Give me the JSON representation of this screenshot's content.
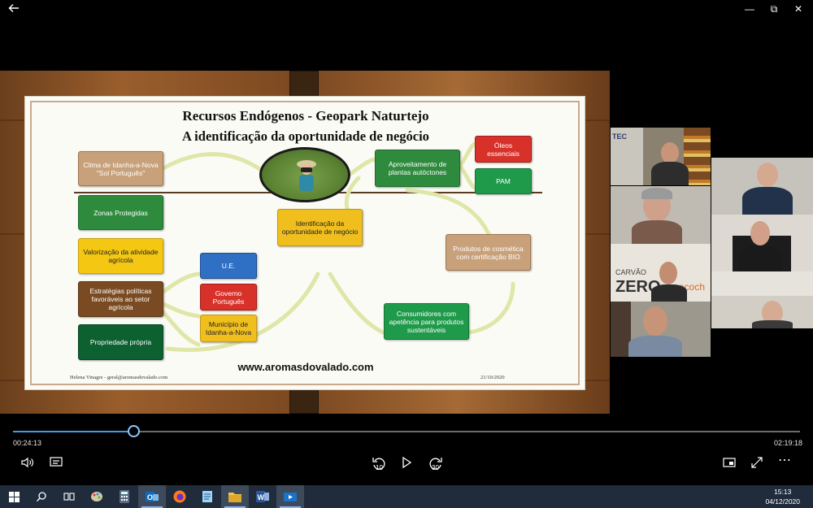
{
  "window": {
    "back_icon": "back-arrow-icon",
    "minimize": "—",
    "restore": "⧉",
    "close": "✕"
  },
  "slide": {
    "title_line1": "Recursos Endógenos  - Geopark Naturtejo",
    "title_line2": "A identificação da oportunidade de negócio",
    "boxes": {
      "clima": "Clima de Idanha-a-Nova \"Sol Português\"",
      "zonas": "Zonas Protegidas",
      "valorizacao": "Valorização da atividade agrícola",
      "estrategias": "Estratégias políticas favoráveis ao setor agrícola",
      "propriedade": "Propriedade própria",
      "ue": "U.E.",
      "governo": "Governo Português",
      "municipio": "Município de Idanha-a-Nova",
      "identificacao": "Identificação da oportunidade de negócio",
      "aproveitamento": "Aproveitamento de plantas autóctones",
      "oleos": "Óleos essenciais",
      "pam": "PAM",
      "produtos": "Produtos de cosmética com certificação BIO",
      "consumidores": "Consumidores com apetência para produtos sustentáveis"
    },
    "url": "www.aromasdovalado.com",
    "footer_left": "Helena Vinagre - geral@aromasdovalado.com",
    "footer_right": "21/10/2020"
  },
  "participants": [
    {
      "name": "participant-1",
      "bg": "#6e6a5c"
    },
    {
      "name": "participant-2",
      "bg": "#b5b0a6"
    },
    {
      "name": "participant-3",
      "bg": "#c9c4bb"
    },
    {
      "name": "participant-4",
      "bg": "#dcd8d0"
    },
    {
      "name": "participant-5",
      "bg": "#c8bfb1"
    },
    {
      "name": "participant-6",
      "bg": "#d8d0c4"
    },
    {
      "name": "participant-7",
      "bg": "#a49f94"
    },
    {
      "name": "participant-8",
      "bg": "#e6e2dc"
    }
  ],
  "tile_text": {
    "carvao": "CARVÃO",
    "zero": "ZERO",
    "eco": "ecoch",
    "tec": "TEC"
  },
  "player": {
    "elapsed": "00:24:13",
    "total": "02:19:18",
    "progress_fraction": 0.154,
    "rewind_label": "10",
    "forward_label": "30",
    "icons": [
      "volume-icon",
      "captions-icon",
      "rewind-10-icon",
      "play-icon",
      "forward-30-icon",
      "miniplayer-icon",
      "fullscreen-icon",
      "more-icon"
    ]
  },
  "taskbar": {
    "time": "15:13",
    "date": "04/12/2020",
    "apps": [
      "windows-start-icon",
      "search-icon",
      "task-view-icon",
      "paint-icon",
      "calculator-icon",
      "outlook-icon",
      "firefox-icon",
      "notepad-icon",
      "file-explorer-icon",
      "word-icon",
      "movies-tv-icon"
    ]
  },
  "colors": {
    "accent": "#3aa0e8",
    "taskbar": "#202c3c",
    "slide_bg": "#fbfbf6"
  }
}
